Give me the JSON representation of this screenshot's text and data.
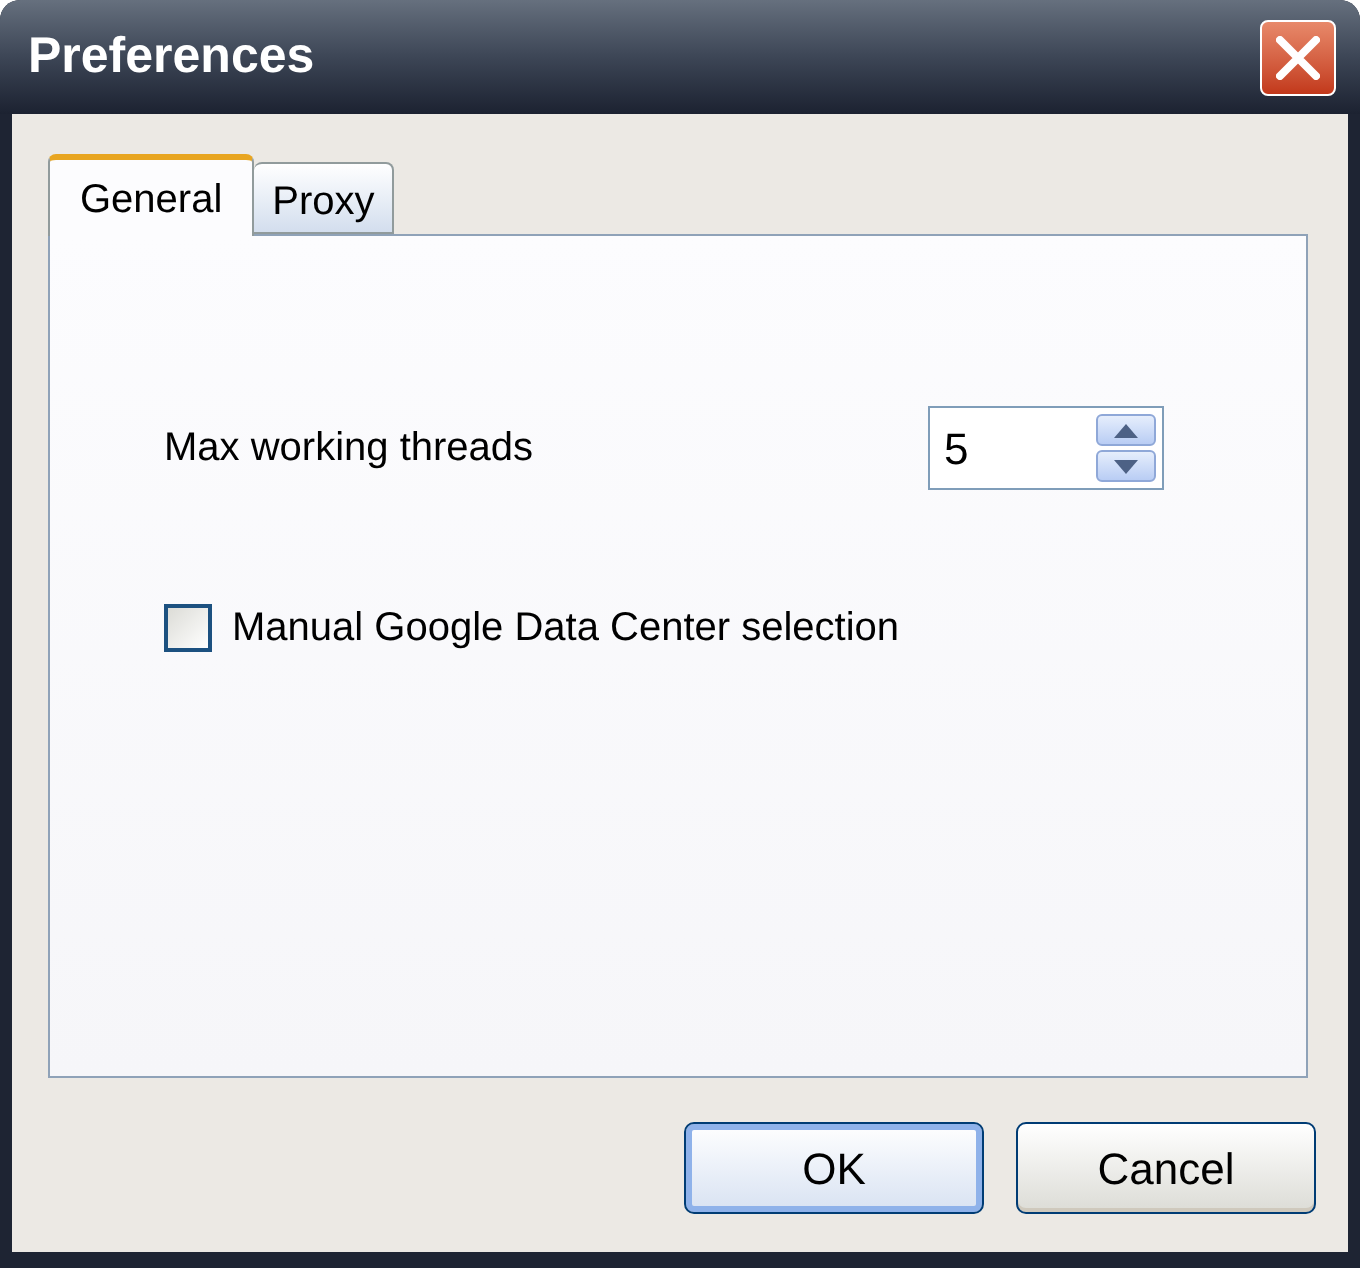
{
  "window": {
    "title": "Preferences"
  },
  "tabs": [
    {
      "label": "General",
      "selected": true
    },
    {
      "label": "Proxy",
      "selected": false
    }
  ],
  "settings": [
    {
      "kind": "spinner",
      "label": "Max working threads",
      "value": "5"
    },
    {
      "kind": "checkbox",
      "label": "Manual Google Data Center selection",
      "checked": false
    }
  ],
  "buttons": [
    {
      "label": "OK",
      "default": true
    },
    {
      "label": "Cancel",
      "default": false
    }
  ]
}
